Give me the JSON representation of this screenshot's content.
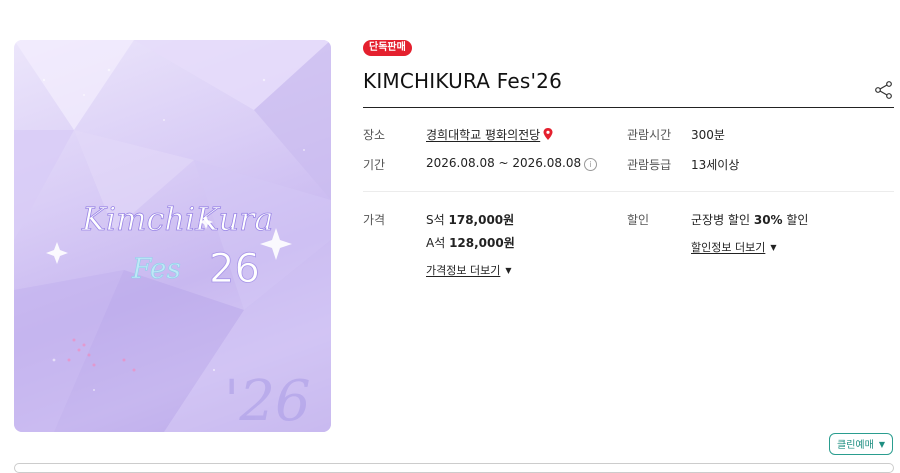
{
  "poster": {
    "logo_line1": "KimchiKura",
    "logo_line2": "Fes",
    "logo_year": "26",
    "corner_year": "'26"
  },
  "badge": "단독판매",
  "title": "KIMCHIKURA Fes'26",
  "info": {
    "venue_label": "장소",
    "venue_value": "경희대학교 평화의전당",
    "period_label": "기간",
    "period_value": "2026.08.08 ~ 2026.08.08",
    "runtime_label": "관람시간",
    "runtime_value": "300분",
    "rating_label": "관람등급",
    "rating_value": "13세이상"
  },
  "price": {
    "label": "가격",
    "items": [
      {
        "seat": "S석",
        "amount": "178,000원"
      },
      {
        "seat": "A석",
        "amount": "128,000원"
      }
    ],
    "more": "가격정보 더보기"
  },
  "discount": {
    "label": "할인",
    "text_prefix": "군장병 할인 ",
    "text_bold": "30%",
    "text_suffix": " 할인",
    "more": "할인정보 더보기"
  },
  "booking_button": "클린예매",
  "colors": {
    "badge": "#e4202e",
    "accent_teal": "#2a9d8f",
    "pin": "#e4202e"
  }
}
